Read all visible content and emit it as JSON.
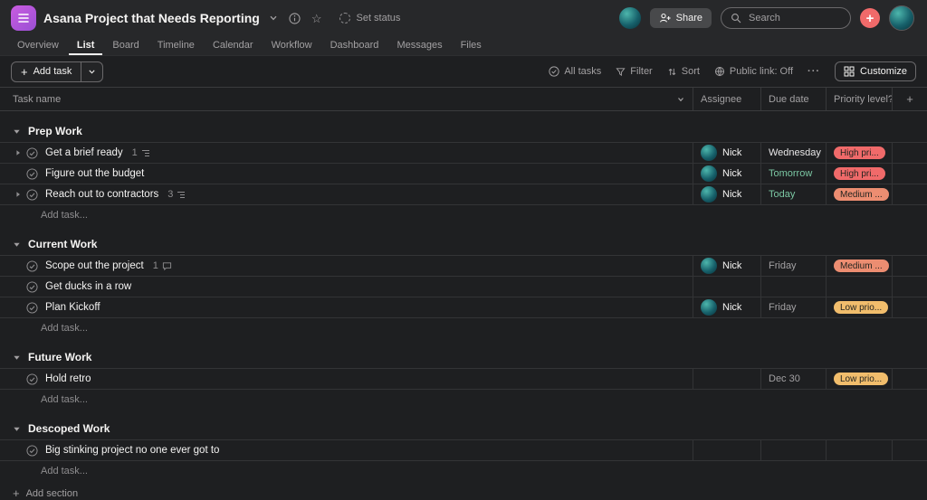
{
  "colors": {
    "background": "#1e1f21",
    "top_background": "#27282a",
    "row_border": "#333436",
    "text_primary": "#f5f4f3",
    "text_secondary": "#a2a0a2",
    "create_button": "#f06a6a",
    "project_icon_purple": "#b35ada",
    "priority_high": "#f06a6a",
    "priority_medium": "#ec8d71",
    "priority_low": "#f1bd6c",
    "due_soon_green": "#7bc7a3"
  },
  "app": {
    "title": "Asana Project that Needs Reporting",
    "set_status_label": "Set status",
    "share_label": "Share",
    "search_placeholder": "Search"
  },
  "tabs": [
    {
      "label": "Overview"
    },
    {
      "label": "List"
    },
    {
      "label": "Board"
    },
    {
      "label": "Timeline"
    },
    {
      "label": "Calendar"
    },
    {
      "label": "Workflow"
    },
    {
      "label": "Dashboard"
    },
    {
      "label": "Messages"
    },
    {
      "label": "Files"
    }
  ],
  "toolbar": {
    "add_task_label": "Add task",
    "all_tasks_label": "All tasks",
    "filter_label": "Filter",
    "sort_label": "Sort",
    "public_link_label": "Public link: Off",
    "more_label": "···",
    "customize_label": "Customize"
  },
  "table": {
    "columns": [
      "Task name",
      "Assignee",
      "Due date",
      "Priority level?"
    ]
  },
  "sections": [
    {
      "name": "Prep Work",
      "add_task_label": "Add task...",
      "tasks": [
        {
          "name": "Get a brief ready",
          "subtask_count": "1",
          "assignee": "Nick",
          "due": "Wednesday",
          "priority": "High pri..."
        },
        {
          "name": "Figure out the budget",
          "assignee": "Nick",
          "due": "Tomorrow",
          "priority": "High pri..."
        },
        {
          "name": "Reach out to contractors",
          "subtask_count": "3",
          "assignee": "Nick",
          "due": "Today",
          "priority": "Medium ..."
        }
      ]
    },
    {
      "name": "Current Work",
      "add_task_label": "Add task...",
      "tasks": [
        {
          "name": "Scope out the project",
          "comment_count": "1",
          "assignee": "Nick",
          "due": "Friday",
          "priority": "Medium ..."
        },
        {
          "name": "Get ducks in a row"
        },
        {
          "name": "Plan Kickoff",
          "assignee": "Nick",
          "due": "Friday",
          "priority": "Low prio..."
        }
      ]
    },
    {
      "name": "Future Work",
      "add_task_label": "Add task...",
      "tasks": [
        {
          "name": "Hold retro",
          "due": "Dec 30",
          "priority": "Low prio..."
        }
      ]
    },
    {
      "name": "Descoped Work",
      "add_task_label": "Add task...",
      "tasks": [
        {
          "name": "Big stinking project no one ever got to"
        }
      ]
    }
  ],
  "add_section_label": "Add section"
}
